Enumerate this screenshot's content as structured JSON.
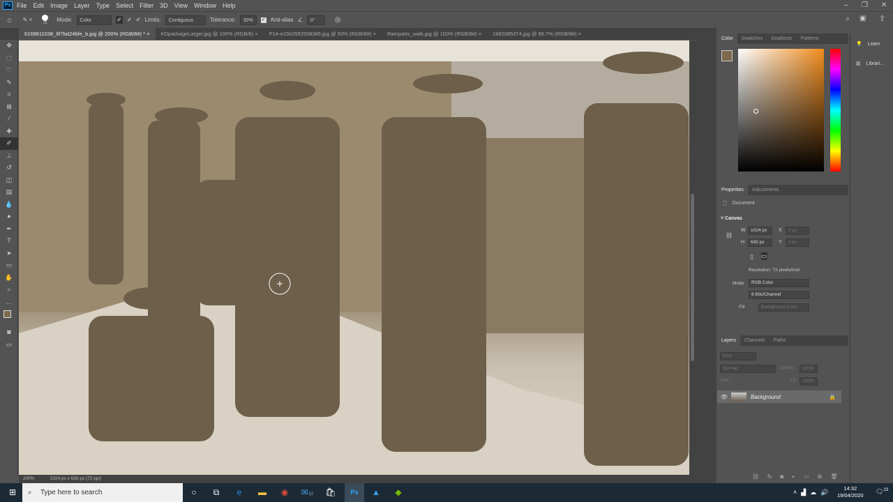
{
  "app": {
    "logo": "Ps"
  },
  "menu": [
    "File",
    "Edit",
    "Image",
    "Layer",
    "Type",
    "Select",
    "Filter",
    "3D",
    "View",
    "Window",
    "Help"
  ],
  "options": {
    "brush_size": "25",
    "mode_label": "Mode:",
    "mode_value": "Color",
    "limits_label": "Limits:",
    "limits_value": "Contiguous",
    "tolerance_label": "Tolerance:",
    "tolerance_value": "30%",
    "antialias_label": "Anti-alias",
    "angle_value": "0°"
  },
  "tabs": [
    {
      "label": "6169811038_6f7bd24bfe_b.jpg @ 200% (RGB/8#) *"
    },
    {
      "label": "KDpackageLarger.jpg @ 100% (RGB/8)"
    },
    {
      "label": "P14-e1562592558386.jpg @ 50% (RGB/8#)"
    },
    {
      "label": "Ramparts_walk.jpg @ 100% (RGB/8#)"
    },
    {
      "label": "1682085374.jpg @ 66.7% (RGB/8#)"
    }
  ],
  "color_panel": {
    "tabs": [
      "Color",
      "Swatches",
      "Gradients",
      "Patterns"
    ],
    "foreground": "#7d6a4e"
  },
  "properties": {
    "tabs": [
      "Properties",
      "Adjustments"
    ],
    "doc_label": "Document",
    "section": "Canvas",
    "w_label": "W",
    "w_value": "1024 px",
    "h_label": "H",
    "h_value": "630 px",
    "x_label": "X",
    "x_value": "0 px",
    "y_label": "Y",
    "y_value": "0 px",
    "resolution": "Resolution: 72 pixels/inch",
    "mode_label": "Mode",
    "mode_value": "RGB Color",
    "bits_value": "8 Bits/Channel",
    "fill_label": "Fill",
    "fill_value": "Background Color"
  },
  "layers": {
    "tabs": [
      "Layers",
      "Channels",
      "Paths"
    ],
    "kind": "Kind",
    "blend": "Normal",
    "opacity_label": "Opacity:",
    "opacity": "100%",
    "lock_label": "Lock:",
    "fill_label": "Fill:",
    "fill": "100%",
    "items": [
      {
        "name": "Background"
      }
    ]
  },
  "far_right": [
    "Learn",
    "Librari..."
  ],
  "status": {
    "zoom": "200%",
    "doc_info": "1024 px x 630 px (72 ppi)"
  },
  "taskbar": {
    "search_placeholder": "Type here to search",
    "mail_badge": "57",
    "time": "14:32",
    "date": "19/04/2020",
    "notif_count": "23"
  }
}
